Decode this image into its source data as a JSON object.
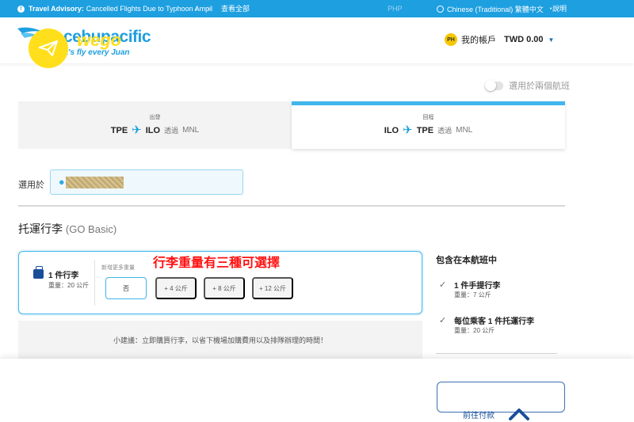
{
  "topbar": {
    "advisory_label": "Travel Advisory:",
    "advisory_text": "Cancelled Flights Due to Typhoon Ampil",
    "view_all": "查看全部",
    "currency": "PHP",
    "language": "Chinese (Traditional) 繁體中文",
    "help": "說明"
  },
  "header": {
    "brand": "cebupacific",
    "tagline": "It's fly every Juan",
    "wego_text": "wego",
    "account_initials": "PH",
    "account_label": "我的帳戶",
    "balance": "TWD 0.00"
  },
  "toggle": {
    "label": "選用於兩個航班"
  },
  "flights": {
    "departure": {
      "label": "出發",
      "from": "TPE",
      "to": "ILO",
      "via": "透過",
      "stop": "MNL"
    },
    "return": {
      "label": "回程",
      "from": "ILO",
      "to": "TPE",
      "via": "透過",
      "stop": "MNL"
    }
  },
  "apply": {
    "label": "選用於"
  },
  "baggage": {
    "title": "托運行李",
    "subtitle": "(GO Basic)",
    "count": "1 件行李",
    "weight": "重量：20 公斤",
    "add_label": "新增更多重量",
    "options": [
      "否",
      "+ 4 公斤",
      "+ 8 公斤",
      "+ 12 公斤"
    ],
    "annotation": "行李重量有三種可選擇",
    "tip": "小建議：立即購買行李，以省下機場加購費用以及排隊辦理的時間！"
  },
  "included": {
    "title": "包含在本航班中",
    "items": [
      {
        "name": "1 件手提行李",
        "weight": "重量：7 公斤"
      },
      {
        "name": "每位乘客 1 件托運行李",
        "weight": "重量：20 公斤"
      }
    ]
  },
  "footer": {
    "pay_label": "前往付款"
  },
  "colors": {
    "brand_blue": "#1d9fe0",
    "navy": "#1a4e9a",
    "annotation_red": "#ff1111",
    "wego_yellow": "#ffdf1b"
  }
}
